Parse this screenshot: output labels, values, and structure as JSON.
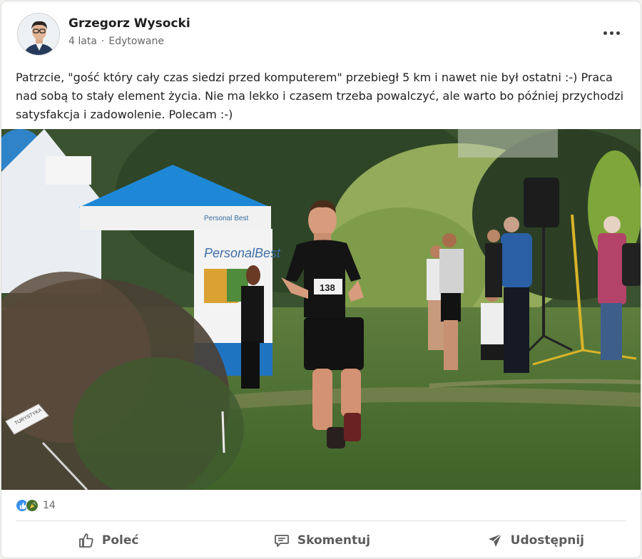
{
  "post": {
    "author": "Grzegorz Wysocki",
    "time": "4 lata",
    "separator": "·",
    "edited": "Edytowane",
    "text": "Patrzcie, \"gość który cały czas siedzi przed komputerem\" przebiegł 5 km i nawet nie był ostatni :-)  Praca nad sobą to stały element życia. Nie ma lekko i czasem trzeba powalczyć, ale warto bo później przychodzi satysfakcja i zadowolenie. Polecam :-)",
    "image": {
      "banner_text": "PersonalBest",
      "tent_brand": "Personal Best",
      "sign_text": "TURYSTYKA",
      "bib_number": "138"
    }
  },
  "reactions": {
    "icons": [
      "like-icon",
      "celebrate-icon"
    ],
    "count": "14"
  },
  "actions": {
    "like": "Poleć",
    "comment": "Skomentuj",
    "share": "Udostępnij"
  },
  "colors": {
    "like_blue": "#378fe9",
    "celebrate_green": "#44712e",
    "tent_blue": "#1e88d6",
    "action_gray": "#5c5c5c"
  }
}
